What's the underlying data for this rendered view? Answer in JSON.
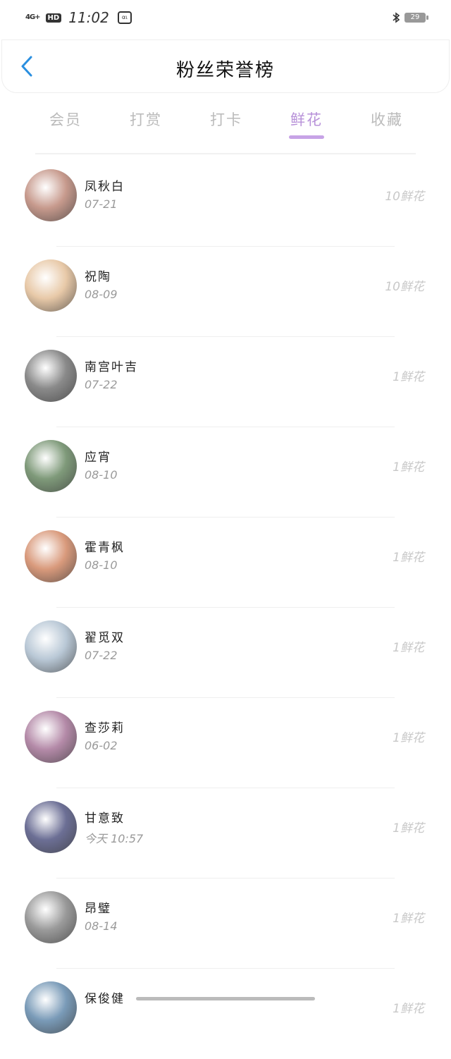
{
  "status_bar": {
    "network": "4G+",
    "hd_badge": "HD",
    "time": "11:02",
    "app_icon_text": "αι",
    "bluetooth_icon": "bluetooth-icon",
    "battery": "29"
  },
  "header": {
    "title": "粉丝荣誉榜",
    "back_icon": "chevron-left-icon"
  },
  "tabs": [
    {
      "label": "会员",
      "active": false
    },
    {
      "label": "打赏",
      "active": false
    },
    {
      "label": "打卡",
      "active": false
    },
    {
      "label": "鲜花",
      "active": true
    },
    {
      "label": "收藏",
      "active": false
    }
  ],
  "colors": {
    "accent": "#c7a3e6",
    "back": "#2a8fe0"
  },
  "fans": [
    {
      "name": "凤秋白",
      "date": "07-21",
      "count": "10鲜花",
      "avatar": "#c79a8d"
    },
    {
      "name": "祝陶",
      "date": "08-09",
      "count": "10鲜花",
      "avatar": "#e8c9a8"
    },
    {
      "name": "南宫叶吉",
      "date": "07-22",
      "count": "1鲜花",
      "avatar": "#8a8a8a"
    },
    {
      "name": "应宵",
      "date": "08-10",
      "count": "1鲜花",
      "avatar": "#7f9a7a"
    },
    {
      "name": "霍青枫",
      "date": "08-10",
      "count": "1鲜花",
      "avatar": "#d99a7c"
    },
    {
      "name": "翟觅双",
      "date": "07-22",
      "count": "1鲜花",
      "avatar": "#b9c8d6"
    },
    {
      "name": "查莎莉",
      "date": "06-02",
      "count": "1鲜花",
      "avatar": "#b48aa8"
    },
    {
      "name": "甘意致",
      "date": "今天 10:57",
      "count": "1鲜花",
      "avatar": "#6c6f95"
    },
    {
      "name": "昂璧",
      "date": "08-14",
      "count": "1鲜花",
      "avatar": "#9a9a9a"
    },
    {
      "name": "保俊健",
      "date": "",
      "count": "1鲜花",
      "avatar": "#7a9bb8"
    }
  ]
}
